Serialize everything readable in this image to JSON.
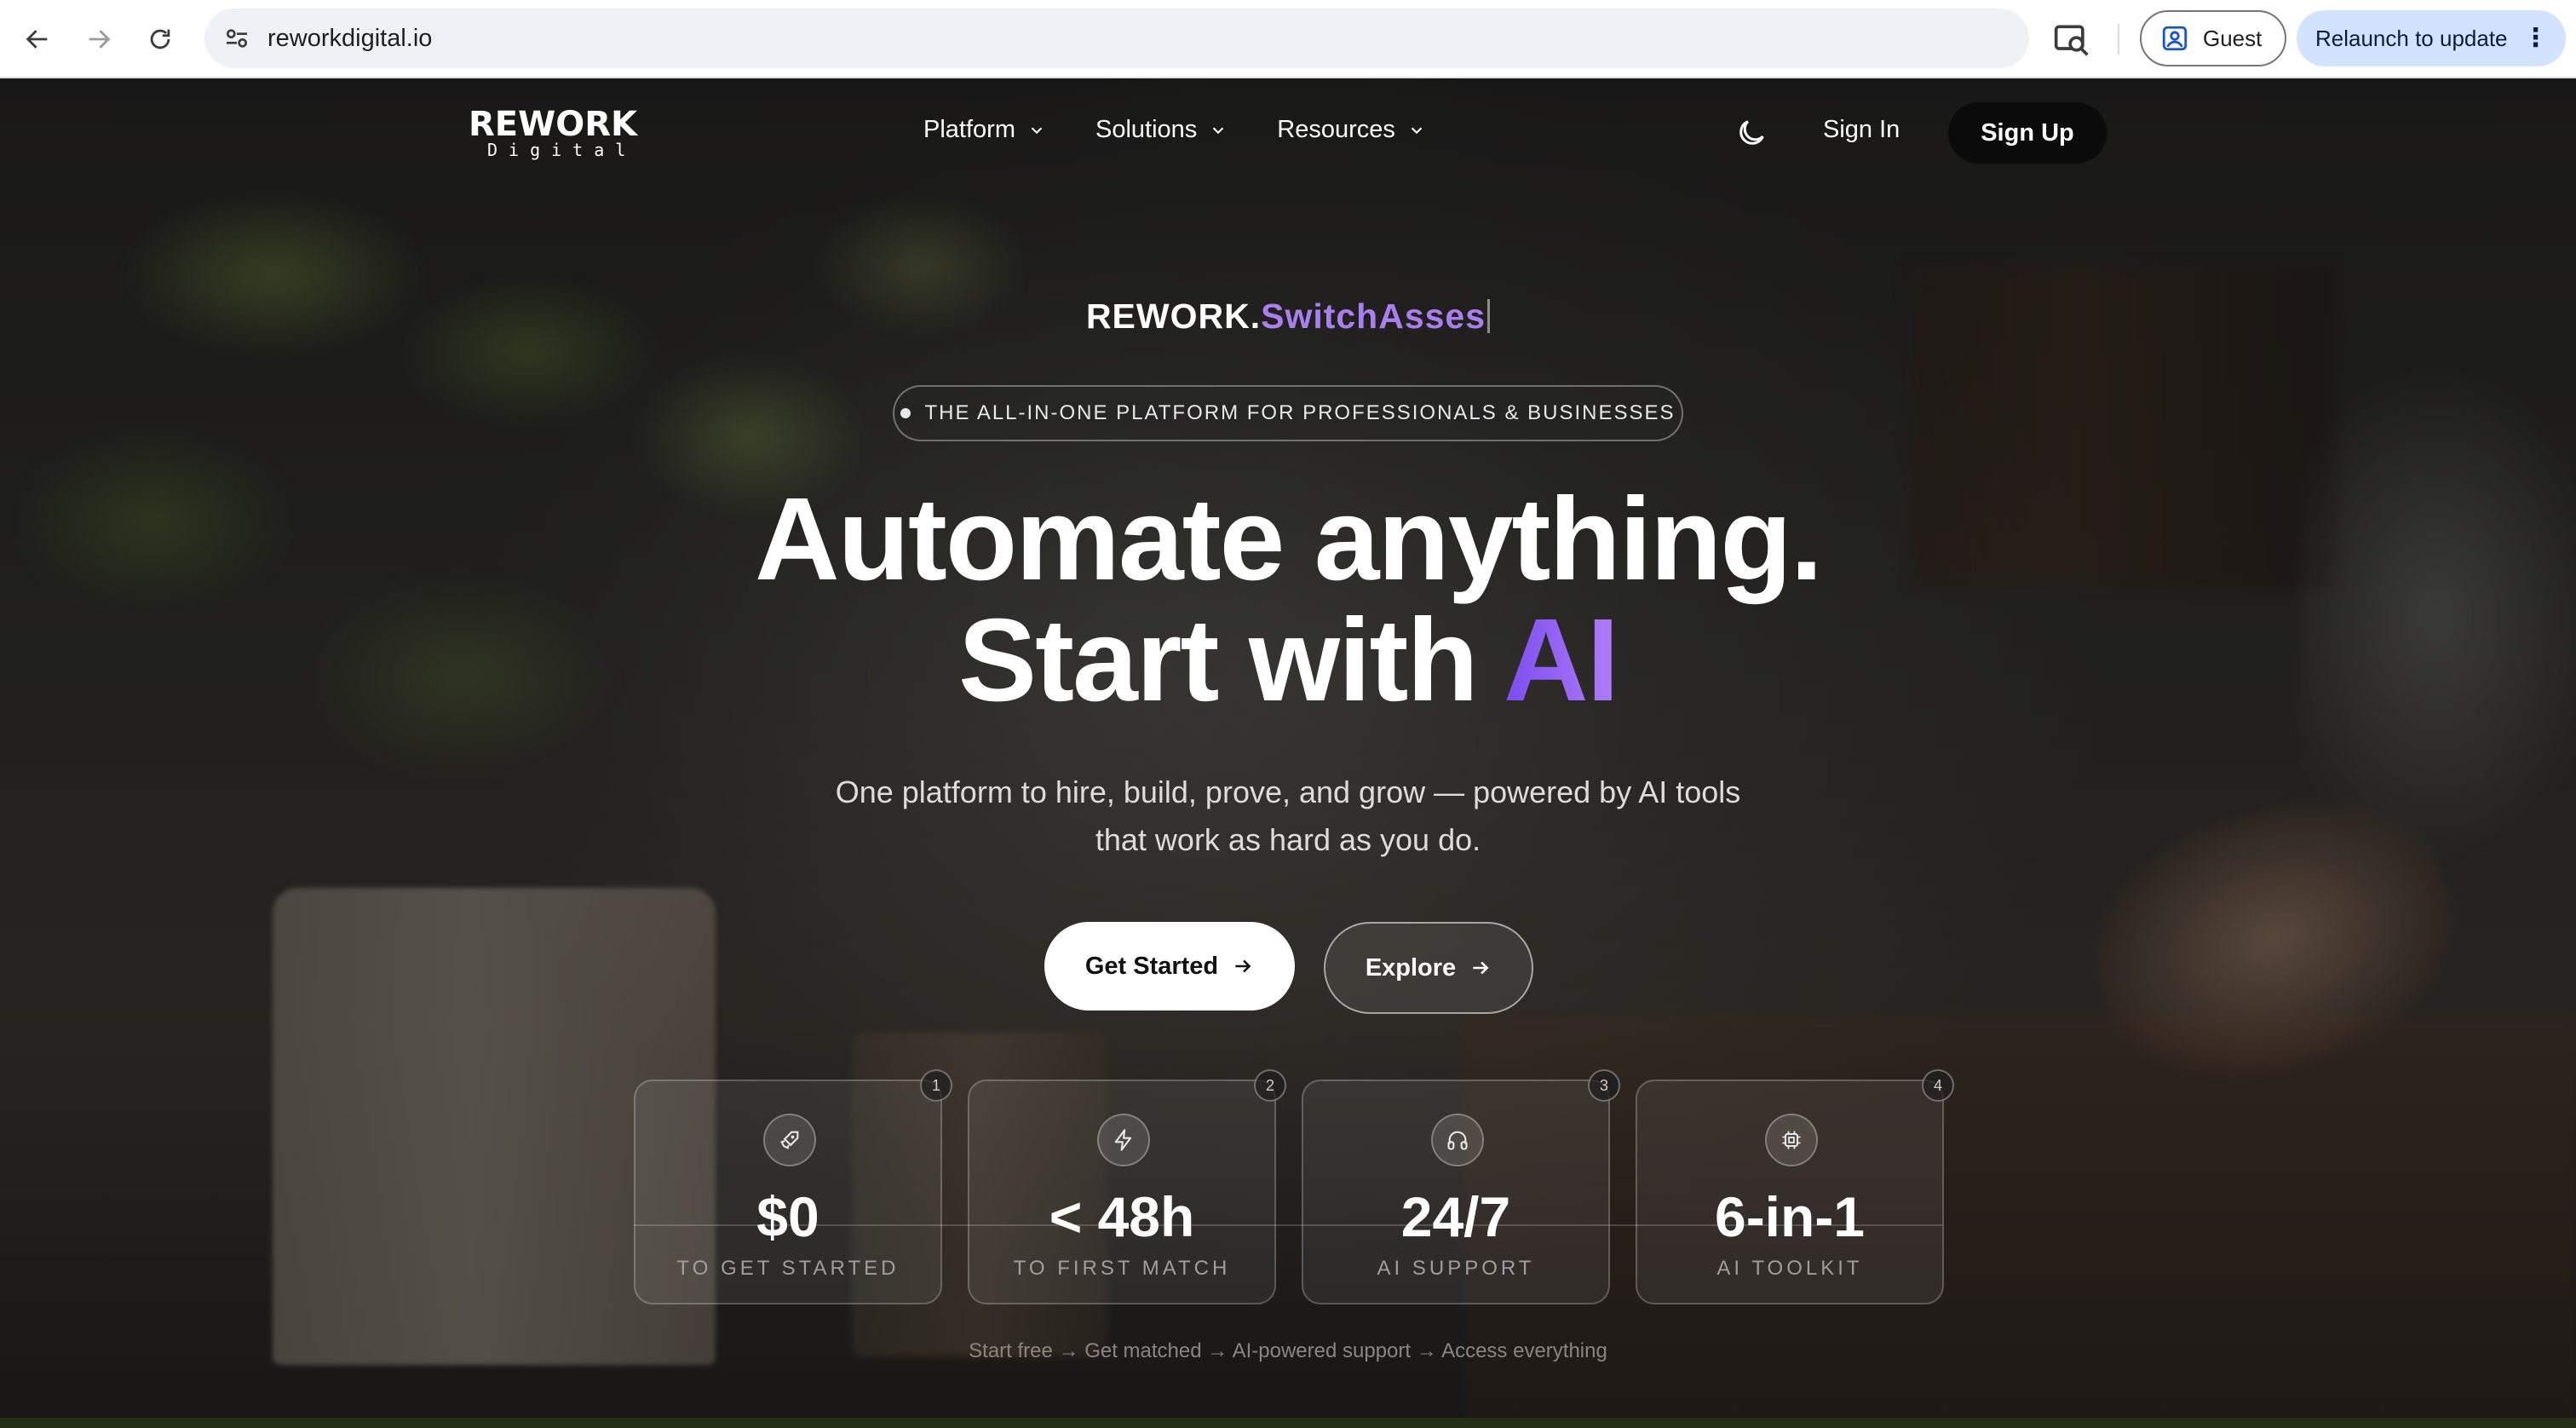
{
  "browser": {
    "url": "reworkdigital.io",
    "profile_label": "Guest",
    "relaunch_label": "Relaunch to update",
    "icons": [
      "back-arrow-icon",
      "forward-arrow-icon",
      "reload-icon",
      "site-settings-icon",
      "google-lens-icon",
      "profile-icon",
      "more-vert-icon"
    ]
  },
  "site": {
    "logo_main": "REWORK",
    "logo_sub": "Digital",
    "menu": [
      {
        "label": "Platform"
      },
      {
        "label": "Solutions"
      },
      {
        "label": "Resources"
      }
    ],
    "signin_label": "Sign In",
    "signup_label": "Sign Up"
  },
  "hero": {
    "brand_prefix": "REWORK.",
    "brand_accent": "SwitchAsses",
    "pill_text": "THE ALL-IN-ONE PLATFORM FOR PROFESSIONALS & BUSINESSES",
    "headline_line1": "Automate anything.",
    "headline_line2_prefix": "Start with ",
    "headline_line2_accent": "AI",
    "subcopy_line1": "One platform to hire, build, prove, and grow — powered by AI tools",
    "subcopy_line2": "that work as hard as you do.",
    "cta_primary": "Get Started",
    "cta_secondary": "Explore",
    "accent_color": "#a97ff0"
  },
  "stats": [
    {
      "step": "1",
      "value": "$0",
      "label": "TO GET STARTED",
      "icon": "rocket-icon"
    },
    {
      "step": "2",
      "value": "< 48h",
      "label": "TO FIRST MATCH",
      "icon": "lightning-icon"
    },
    {
      "step": "3",
      "value": "24/7",
      "label": "AI SUPPORT",
      "icon": "headphones-icon"
    },
    {
      "step": "4",
      "value": "6-in-1",
      "label": "AI TOOLKIT",
      "icon": "chip-icon"
    }
  ],
  "flow_text": "Start free → Get matched → AI-powered support → Access everything"
}
